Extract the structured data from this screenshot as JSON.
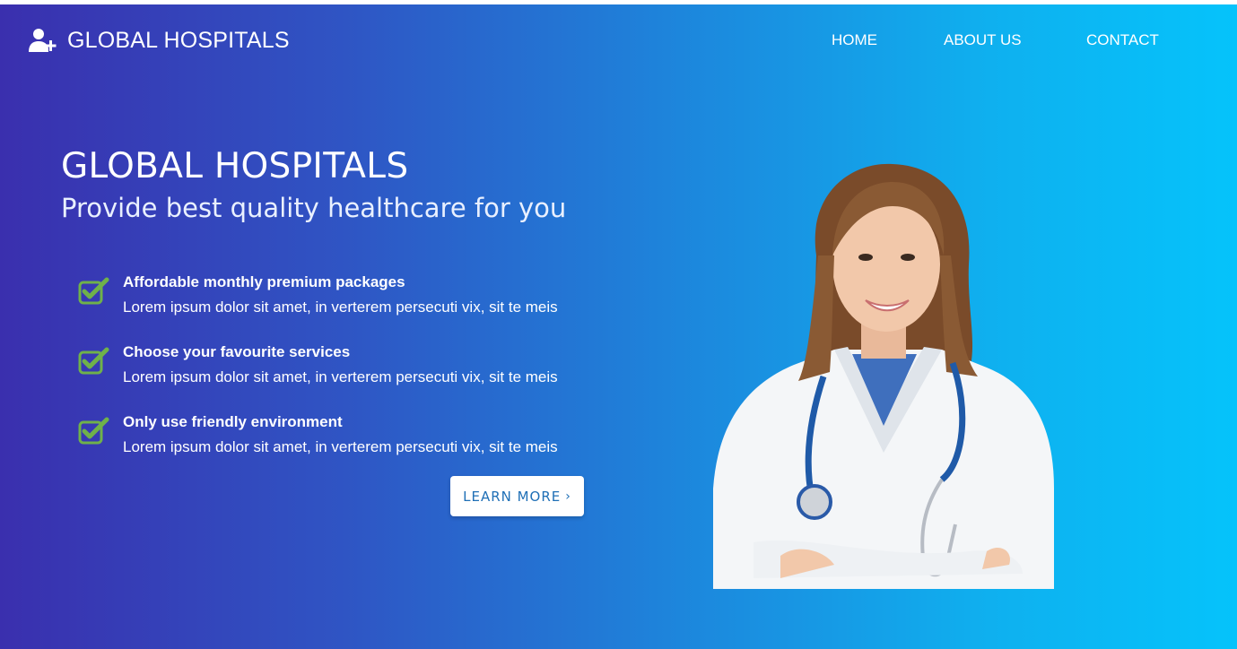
{
  "brand": {
    "icon": "user-plus-icon",
    "name": "GLOBAL HOSPITALS"
  },
  "nav": {
    "items": [
      "HOME",
      "ABOUT US",
      "CONTACT"
    ]
  },
  "hero": {
    "title": "GLOBAL HOSPITALS",
    "subtitle": "Provide best quality healthcare for you",
    "features": [
      {
        "icon": "check-square-icon",
        "title": "Affordable monthly premium packages",
        "description": "Lorem ipsum dolor sit amet, in verterem persecuti vix, sit te meis"
      },
      {
        "icon": "check-square-icon",
        "title": "Choose your favourite services",
        "description": "Lorem ipsum dolor sit amet, in verterem persecuti vix, sit te meis"
      },
      {
        "icon": "check-square-icon",
        "title": "Only use friendly environment",
        "description": "Lorem ipsum dolor sit amet, in verterem persecuti vix, sit te meis"
      }
    ],
    "cta_label": "LEARN MORE",
    "cta_icon": "chevron-right-icon"
  },
  "colors": {
    "gradient_start": "#3a2fae",
    "gradient_end": "#05c3fb",
    "check_green": "#6fb14a",
    "cta_text": "#1f6fb6"
  }
}
